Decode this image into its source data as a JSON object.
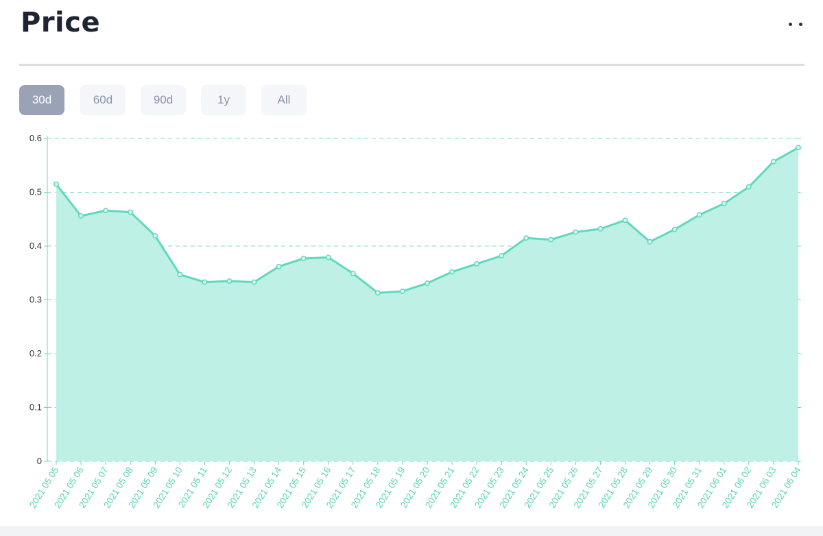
{
  "header": {
    "title": "Price"
  },
  "range_tabs": [
    {
      "label": "30d",
      "active": true
    },
    {
      "label": "60d",
      "active": false
    },
    {
      "label": "90d",
      "active": false
    },
    {
      "label": "1y",
      "active": false
    },
    {
      "label": "All",
      "active": false
    }
  ],
  "colors": {
    "line": "#5fd9bd",
    "fill": "#bef0e6",
    "grid": "#67d9be",
    "tick_label": "#58d3b6",
    "axis_text": "#333333"
  },
  "chart_data": {
    "type": "area",
    "x": [
      "2021 05 05",
      "2021 05 06",
      "2021 05 07",
      "2021 05 08",
      "2021 05 09",
      "2021 05 10",
      "2021 05 11",
      "2021 05 12",
      "2021 05 13",
      "2021 05 14",
      "2021 05 15",
      "2021 05 16",
      "2021 05 17",
      "2021 05 18",
      "2021 05 19",
      "2021 05 20",
      "2021 05 21",
      "2021 05 22",
      "2021 05 23",
      "2021 05 24",
      "2021 05 25",
      "2021 05 26",
      "2021 05 27",
      "2021 05 28",
      "2021 05 29",
      "2021 05 30",
      "2021 05 31",
      "2021 06 01",
      "2021 06 02",
      "2021 06 03",
      "2021 06 04"
    ],
    "values": [
      0.515,
      0.456,
      0.466,
      0.463,
      0.419,
      0.347,
      0.333,
      0.335,
      0.333,
      0.362,
      0.377,
      0.379,
      0.349,
      0.313,
      0.316,
      0.331,
      0.352,
      0.367,
      0.382,
      0.415,
      0.412,
      0.426,
      0.432,
      0.448,
      0.408,
      0.431,
      0.458,
      0.479,
      0.51,
      0.557,
      0.583
    ],
    "ylim": [
      0,
      0.6
    ],
    "yticks": [
      "0",
      "0.1",
      "0.2",
      "0.3",
      "0.4",
      "0.5",
      "0.6"
    ],
    "grid": true,
    "title": "",
    "xlabel": "",
    "ylabel": ""
  }
}
